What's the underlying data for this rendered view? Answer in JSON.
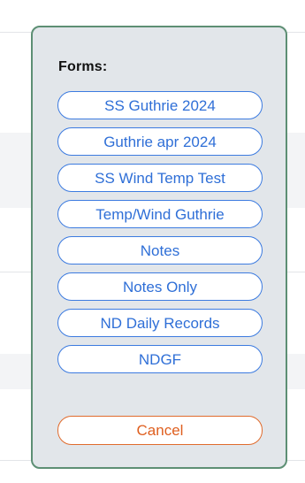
{
  "modal": {
    "title": "Forms:",
    "forms": [
      {
        "label": "SS Guthrie 2024"
      },
      {
        "label": "Guthrie apr 2024"
      },
      {
        "label": "SS Wind Temp Test"
      },
      {
        "label": "Temp/Wind Guthrie"
      },
      {
        "label": "Notes"
      },
      {
        "label": "Notes Only"
      },
      {
        "label": "ND Daily Records"
      },
      {
        "label": "NDGF"
      }
    ],
    "cancel_label": "Cancel"
  },
  "colors": {
    "modal_background": "#e2e6ea",
    "modal_border": "#5d8f74",
    "button_accent": "#2f6fd7",
    "cancel_accent": "#df5f1f"
  }
}
